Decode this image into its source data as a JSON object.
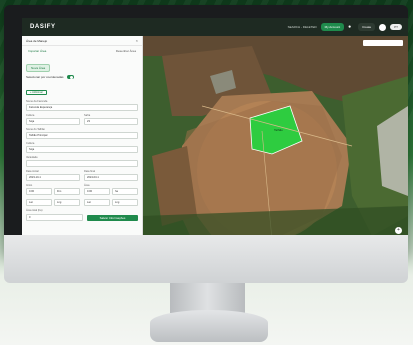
{
  "app": {
    "logo": "DASIFY"
  },
  "header": {
    "user_text": "SEARCH - DELETED",
    "btn_primary": "My Account",
    "btn_secondary": "Create",
    "lang": "PT"
  },
  "panel": {
    "title": "Área de Manejo",
    "close": "×",
    "tabs": [
      "Importar Área",
      "Desenhar Área"
    ],
    "chip": "Nova Área",
    "toggle_label": "Selecionar por coordenadas",
    "outline_btn": "+ Adicionar",
    "fields": [
      {
        "label": "Nome da Fazenda",
        "value": "Fazenda Esperança"
      },
      {
        "label": "Nome do Talhão",
        "value": "Talhão Principal"
      },
      {
        "label": "Cultura",
        "value": "Soja"
      },
      {
        "label": "Variedade",
        "value": ""
      }
    ],
    "pair1": {
      "l1": "Cultura",
      "v1": "Soja",
      "l2": "Safra",
      "v2": "23"
    },
    "pair2": {
      "l1": "Data inicial",
      "v1": "2023-10-1",
      "l2": "Data final",
      "v2": "2024-03-1"
    },
    "pair3": {
      "l1": "Início",
      "v1": "0.00",
      "v1b": "Fim",
      "l2": "Área",
      "v2": "0.00",
      "v2b": "ha"
    },
    "pair4": {
      "v1": "Lat",
      "v1b": "Lng",
      "v2": "Lat",
      "v2b": "Lng"
    },
    "area_label": "Área total (ha)",
    "area_value": "0",
    "save_btn": "Salvar Informações"
  },
  "map": {
    "field_label": "Talhão",
    "zoom_label": "+"
  },
  "colors": {
    "accent": "#1f8a4c",
    "highlight_field": "#2ecc40"
  }
}
